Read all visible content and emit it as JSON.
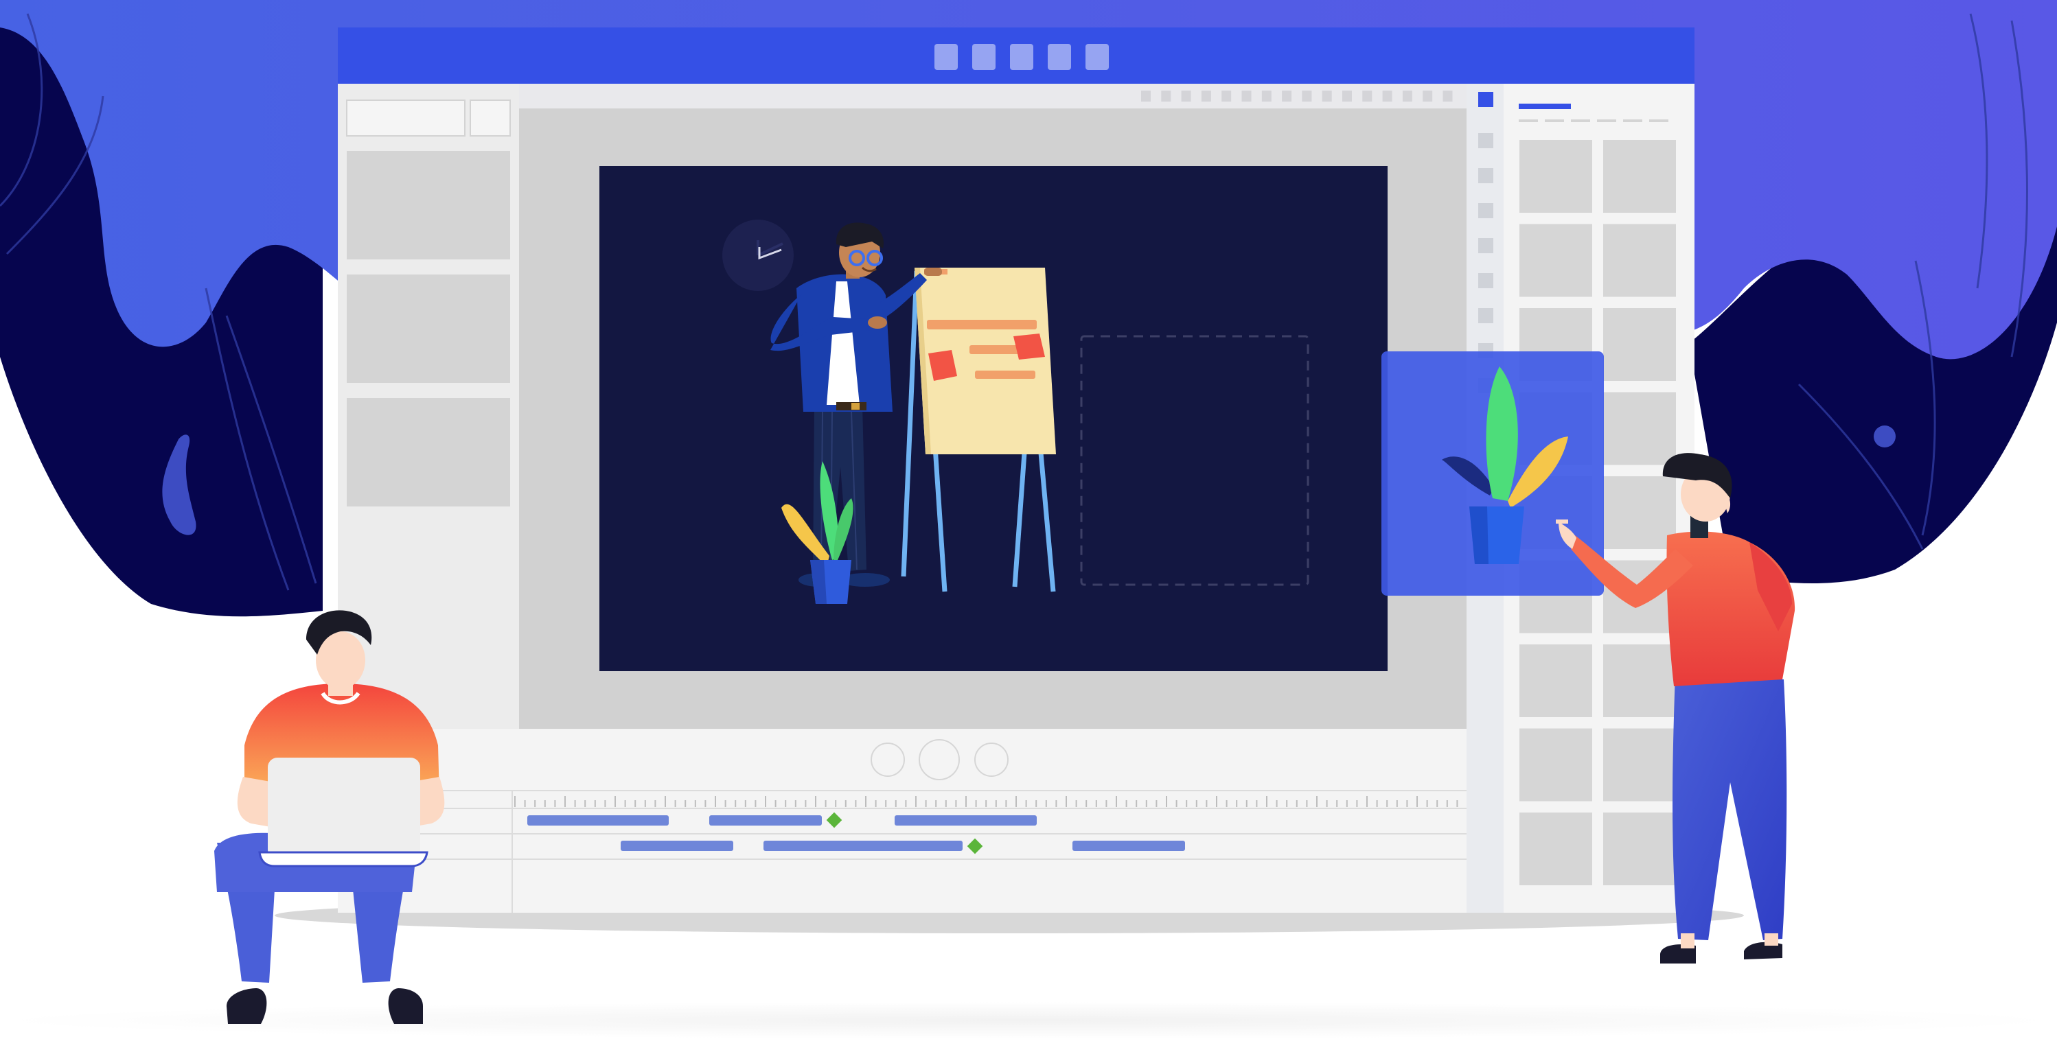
{
  "colors": {
    "background": "#ffffff",
    "blob_light": "#4356e0",
    "blob_dark": "#06054e",
    "window_titlebar": "#3550e6",
    "titlebar_button": "#96a4f2",
    "panel_gray": "#ececec",
    "canvas_gray": "#d1d1d1",
    "slide_background": "#131741",
    "timeline_bar": "#6e86d9",
    "keyframe": "#5bb53a",
    "selection_overlay": "#3f5ae6",
    "shirt_orange": "#f3624b",
    "pants_blue": "#4a5fd8",
    "plant_green": "#4ddd7a",
    "plant_yellow": "#f5c64a",
    "flipchart_paper": "#f7e5ad",
    "sticky_note": "#f25445"
  },
  "icons": [
    "window-control-icon",
    "clock-icon",
    "play-control-icon",
    "plant-icon",
    "presenter-figure",
    "flipchart-illustration"
  ],
  "editor": {
    "titlebar_buttons": 5,
    "timeline_tracks": 2,
    "thumbnail_rows": 9
  }
}
